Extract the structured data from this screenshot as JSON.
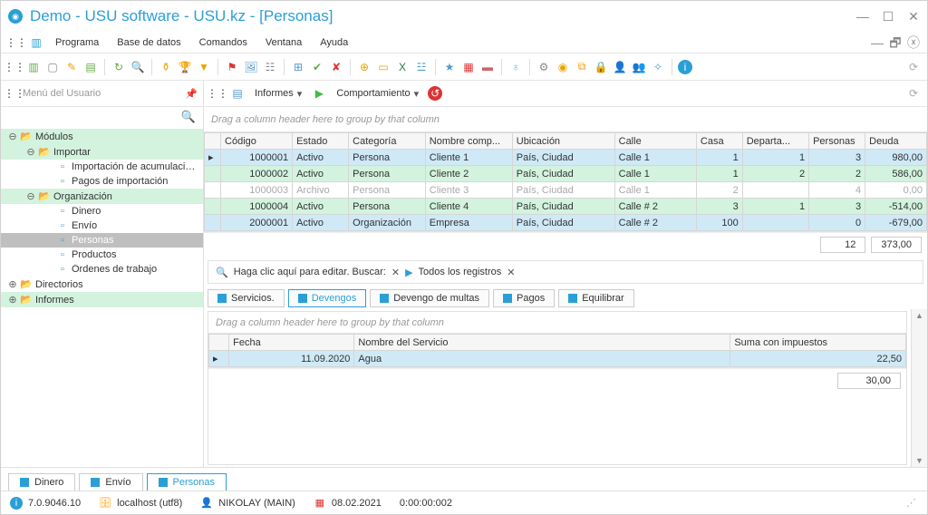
{
  "title": "Demo - USU software - USU.kz - [Personas]",
  "menus": [
    "Programa",
    "Base de datos",
    "Comandos",
    "Ventana",
    "Ayuda"
  ],
  "sidebar": {
    "header": "Menú del Usuario",
    "items": [
      {
        "label": "Módulos",
        "level": 1,
        "open": true,
        "folder": true,
        "hl": "green"
      },
      {
        "label": "Importar",
        "level": 2,
        "open": true,
        "folder": true,
        "hl": "green"
      },
      {
        "label": "Importación de acumulaciones",
        "level": 3,
        "folder": false
      },
      {
        "label": "Pagos de importación",
        "level": 3,
        "folder": false
      },
      {
        "label": "Organización",
        "level": 2,
        "open": true,
        "folder": true,
        "hl": "green"
      },
      {
        "label": "Dinero",
        "level": 3,
        "folder": false
      },
      {
        "label": "Envío",
        "level": 3,
        "folder": false
      },
      {
        "label": "Personas",
        "level": 3,
        "folder": false,
        "selected": true
      },
      {
        "label": "Productos",
        "level": 3,
        "folder": false
      },
      {
        "label": "Órdenes de trabajo",
        "level": 3,
        "folder": false
      },
      {
        "label": "Directorios",
        "level": 1,
        "open": false,
        "folder": true
      },
      {
        "label": "Informes",
        "level": 1,
        "open": false,
        "folder": true,
        "hl": "green"
      }
    ]
  },
  "secondary_toolbar": {
    "reports": "Informes",
    "behavior": "Comportamiento"
  },
  "group_hint": "Drag a column header here to group by that column",
  "grid": {
    "columns": [
      "Código",
      "Estado",
      "Categoría",
      "Nombre comp...",
      "Ubicación",
      "Calle",
      "Casa",
      "Departa...",
      "Personas",
      "Deuda"
    ],
    "rows": [
      {
        "sel": true,
        "cls": "row-blue",
        "cells": [
          "1000001",
          "Activo",
          "Persona",
          "Cliente 1",
          "País, Ciudad",
          "Calle 1",
          "1",
          "1",
          "3",
          "980,00"
        ]
      },
      {
        "cls": "row-green",
        "cells": [
          "1000002",
          "Activo",
          "Persona",
          "Cliente 2",
          "País, Ciudad",
          "Calle 1",
          "1",
          "2",
          "2",
          "586,00"
        ]
      },
      {
        "cls": "row-arch",
        "cells": [
          "1000003",
          "Archivo",
          "Persona",
          "Cliente 3",
          "País, Ciudad",
          "Calle 1",
          "2",
          "",
          "4",
          "0,00"
        ]
      },
      {
        "cls": "row-green",
        "cells": [
          "1000004",
          "Activo",
          "Persona",
          "Cliente 4",
          "País, Ciudad",
          "Calle # 2",
          "3",
          "1",
          "3",
          "-514,00"
        ]
      },
      {
        "cls": "row-blue",
        "cells": [
          "2000001",
          "Activo",
          "Organización",
          "Empresa",
          "País, Ciudad",
          "Calle # 2",
          "100",
          "",
          "0",
          "-679,00"
        ]
      }
    ],
    "footer": {
      "persons": "12",
      "debt": "373,00"
    }
  },
  "searchbar": {
    "edit_hint": "Haga clic aquí para editar. Buscar:",
    "all_records": "Todos los registros"
  },
  "detail_tabs": [
    "Servicios.",
    "Devengos",
    "Devengo de multas",
    "Pagos",
    "Equilibrar"
  ],
  "detail_active": 1,
  "detail_grid": {
    "columns": [
      "Fecha",
      "Nombre del Servicio",
      "Suma con impuestos"
    ],
    "rows": [
      {
        "sel": true,
        "cls": "row-blue",
        "cells": [
          "11.09.2020",
          "Agua",
          "22,50"
        ]
      }
    ],
    "footer": {
      "sum": "30,00"
    }
  },
  "doc_tabs": [
    "Dinero",
    "Envío",
    "Personas"
  ],
  "doc_active": 2,
  "status": {
    "version": "7.0.9046.10",
    "host": "localhost (utf8)",
    "user": "NIKOLAY (MAIN)",
    "date": "08.02.2021",
    "timer": "0:00:00:002"
  }
}
